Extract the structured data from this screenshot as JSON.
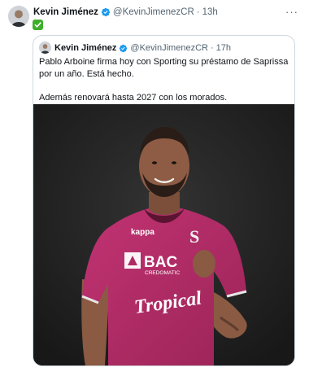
{
  "tweet": {
    "author_name": "Kevin Jiménez",
    "author_handle": "@KevinJimenezCR",
    "separator": "·",
    "time": "13h",
    "more_label": "···",
    "body_emoji": "check-mark-button-emoji",
    "quoted": {
      "author_name": "Kevin Jiménez",
      "author_handle": "@KevinJimenezCR",
      "separator": "·",
      "time": "17h",
      "paragraph_1": "Pablo Arboine firma hoy con Sporting su préstamo de Saprissa por un año. Está hecho.",
      "paragraph_2": "Además renovará hasta 2027 con los morados.",
      "photo": {
        "jersey_brand": "kappa",
        "sponsor_main": "BAC",
        "sponsor_sub": "CREDOMATIC",
        "sponsor_front": "Tropical",
        "crest_letter": "S"
      }
    }
  },
  "colors": {
    "verified_blue": "#1d9bf0",
    "secondary_text": "#536471",
    "border": "#cfd9de",
    "jersey": "#b02a62",
    "photo_background": "#202020",
    "check_green": "#3fae2a"
  }
}
